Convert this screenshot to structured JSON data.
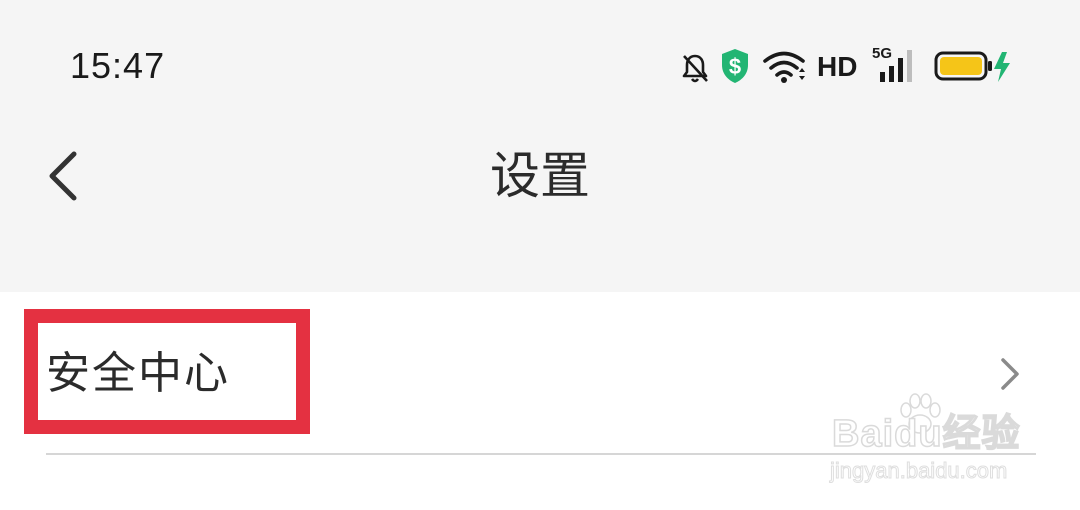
{
  "status_bar": {
    "time": "15:47",
    "network_label": "HD",
    "network_gen": "5G",
    "icons": [
      "bell-off-icon",
      "shield-dollar-icon",
      "wifi-icon",
      "cellular-signal-icon",
      "battery-charging-icon"
    ],
    "colors": {
      "shield": "#22b573",
      "battery_fill": "#f5c518",
      "charging": "#22b573"
    }
  },
  "nav": {
    "title": "设置",
    "back_icon": "chevron-left-icon"
  },
  "settings_list": {
    "items": [
      {
        "label": "安全中心",
        "icon": "chevron-right-icon"
      }
    ]
  },
  "annotation": {
    "highlight_color": "#e43141"
  },
  "watermark": {
    "logo": "Baidu经验",
    "url": "jingyan.baidu.com"
  }
}
